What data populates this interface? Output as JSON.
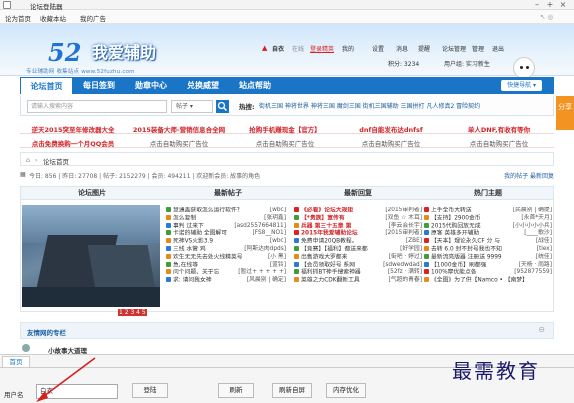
{
  "window": {
    "title": "论坛登陆器",
    "controls": [
      "–",
      "+",
      "×"
    ]
  },
  "menubar": {
    "items": [
      "论为首页",
      "收藏本站",
      "我的广告"
    ],
    "icons": "↖ ◎"
  },
  "banner": {
    "logo_number": "52",
    "logo_name": "我爱辅助",
    "logo_sub": "专业辅助网 收集站点 www.52fuzhu.com",
    "user": "自衣",
    "status": "在线",
    "level": "登录精英",
    "links": [
      "我的",
      "设置",
      "消息",
      "提醒",
      "论坛管理",
      "管理",
      "退出"
    ],
    "points": "积分: 3234",
    "group": "用户组: 实习新生"
  },
  "nav": {
    "tabs": [
      "论坛首页",
      "每日签到",
      "勋章中心",
      "兑换威望",
      "站点帮助"
    ],
    "quicknav": "快捷导航 ▾"
  },
  "search": {
    "placeholder": "请输入搜索内容",
    "type": "帖子 ▾",
    "hot_label": "热搜:",
    "hot_items": "街机三国  神将世界  神将三国  魔剑三国  街机三国辅助  三国拼打  凡人修真2  冒险契约"
  },
  "share": {
    "label": "分享"
  },
  "ads": {
    "row1": [
      "逆天2015突至年修改器大全",
      "2015装备大师-营销信息合全网",
      "抢购手机赚现金【官方】",
      "dnf自能发布达dnfsf",
      "单人DNF,有收有等你"
    ],
    "row2": [
      "点击免费换购一个月QQ会员",
      "点击自助购买广告位",
      "点击自助购买广告位",
      "点击自助购买广告位",
      "点击自助购买广告位"
    ]
  },
  "crumb": {
    "home": "⌂",
    "sep": "›",
    "label": "论坛首页"
  },
  "stats": {
    "text": "今日: 856 | 昨日: 27708 | 帖子: 2152279 | 会员: 494211 | 欢迎新会员: 故事的角色",
    "right": "我的帖子  最新回复"
  },
  "grid": {
    "headers": [
      "论坛图片",
      "最新帖子",
      "最新回复",
      "热门主题"
    ],
    "dots": "1 2 3 4 5",
    "latest": [
      {
        "t": "慧通盖获取怎么运行软件?",
        "tag": "[wbc]",
        "c": "#3f9e3a"
      },
      {
        "t": "怎么复制",
        "tag": "[张玥鑫]",
        "c": "#e68a1a"
      },
      {
        "t": "事判 过来下",
        "tag": "[asd2557664811]",
        "c": "#2b7bd6"
      },
      {
        "t": "卡诺的辅助 全图解可",
        "tag": "[FS8__NO1]",
        "c": "#3f9e3a"
      },
      {
        "t": "死神VS火影3.9",
        "tag": "[wbc]",
        "c": "#e68a1a"
      },
      {
        "t": "三线 水管 鸡",
        "tag": "[阿斯达肉dpds]",
        "c": "#2b7bd6"
      },
      {
        "t": "欢生无无先去处火线精英号",
        "tag": "[小 黑]",
        "c": "#e68a1a"
      },
      {
        "t": "急,在线等",
        "tag": "[蓝铃]",
        "c": "#3f9e3a"
      },
      {
        "t": "问个问题、关于忘",
        "tag": "[暂过+ + + + +]",
        "c": "#e68a1a"
      },
      {
        "t": "求: 请问我女神",
        "tag": "[风晨别 | 确定]",
        "c": "#2b7bd6"
      }
    ],
    "replies": [
      {
        "t": "《必看》论坛大规矩",
        "tag": "[2015审判者]",
        "c": "#d22",
        "red": true
      },
      {
        "t": "【*贵族】宣传有",
        "tag": "[双鱼 ☆ 木耳]",
        "c": "#3f9e3a",
        "red": true
      },
      {
        "t": "兵器 第三十五章 第",
        "tag": "[李云会长宇]",
        "c": "#e68a1a",
        "red": true
      },
      {
        "t": "2015年我爱辅助论坛",
        "tag": "[2015审判者]",
        "c": "#d22",
        "red": true
      },
      {
        "t": "免费申请20QB教程。",
        "tag": "[ZBE]",
        "c": "#2b7bd6"
      },
      {
        "t": "【竞赛】【福利】都送来都",
        "tag": "[好学园]",
        "c": "#3f9e3a"
      },
      {
        "t": "出售游戏大罗都来",
        "tag": "[街吧 · 婷过]",
        "c": "#e68a1a"
      },
      {
        "t": "【会员领取好号 系网",
        "tag": "[sdwedwdad]",
        "c": "#2b7bd6"
      },
      {
        "t": "福利抓BT神手搜索神器",
        "tag": "[52fz · 满转]",
        "c": "#3f9e3a"
      },
      {
        "t": "英雄之力CDK翻新工具",
        "tag": "[气超的青春]",
        "c": "#e68a1a"
      }
    ],
    "hot": [
      {
        "t": "上手全币大转送",
        "tag": "[民晨别 | 确提]",
        "c": "#d22"
      },
      {
        "t": "【支持】2900金币",
        "tag": "[永首*天月]",
        "c": "#e68a1a"
      },
      {
        "t": "2015代购回放无成",
        "tag": "[小小小小小兵]",
        "c": "#3f9e3a"
      },
      {
        "t": "原客 英雄多开辅助",
        "tag": "[____歌沙]",
        "c": "#2b7bd6"
      },
      {
        "t": "【天本】理论永久CF 分 与",
        "tag": "[战佳]",
        "c": "#d22"
      },
      {
        "t": "去转 6.0 封不封号我也不知",
        "tag": "[tlex]",
        "c": "#e68a1a"
      },
      {
        "t": "最新流亮版器 注册送 9999",
        "tag": "[统佳]",
        "c": "#3f9e3a"
      },
      {
        "t": "【1000金币】刷都强",
        "tag": "[天杨 · 雨路]",
        "c": "#2b7bd6"
      },
      {
        "t": "100%摩优能点各",
        "tag": "[952877559]",
        "c": "#d22"
      },
      {
        "t": "《全图》为了供【Namco • 【南梦】",
        "tag": "",
        "c": "#e68a1a"
      }
    ]
  },
  "section2": {
    "label": "友情网的专栏"
  },
  "section3": {
    "label": "小故事大道理"
  },
  "bottom": {
    "tab": "首页",
    "user_label": "用户名",
    "user_value": "白衣",
    "login": "登陆",
    "refresh": "刷新",
    "refresh_auto": "刷新自屏",
    "memory": "内存优化"
  },
  "watermark": "最需教育",
  "colors": {
    "nav_blue": "#1b75c6",
    "share_orange": "#f39321",
    "ad_red": "#d0262a"
  }
}
